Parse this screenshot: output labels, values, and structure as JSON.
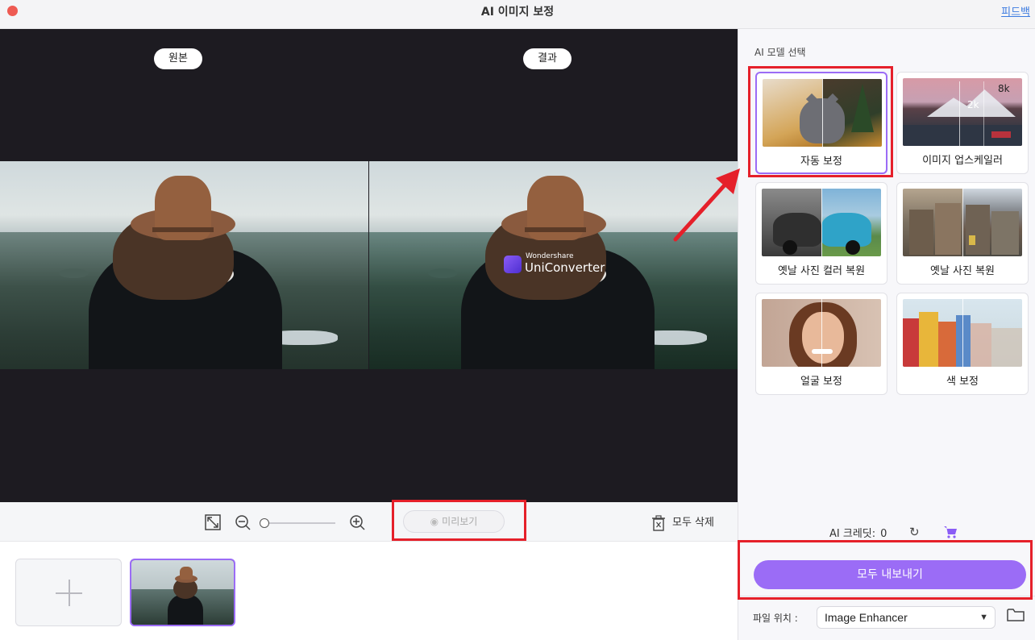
{
  "window": {
    "title": "AI 이미지 보정",
    "feedback_link": "피드백"
  },
  "preview": {
    "original_label": "원본",
    "result_label": "결과",
    "watermark": {
      "brand_small": "Wondershare",
      "brand_big": "UniConverter"
    }
  },
  "toolbar": {
    "preview_button": "미리보기",
    "delete_all": "모두 삭제",
    "zoom_level": 0
  },
  "panel": {
    "section_title": "AI 모델 선택",
    "models": [
      {
        "label": "자동 보정",
        "selected": true
      },
      {
        "label": "이미지 업스케일러",
        "selected": false,
        "badge_8k": "8k",
        "badge_2k": "2k"
      },
      {
        "label": "옛날 사진 컬러 복원",
        "selected": false
      },
      {
        "label": "옛날 사진 복원",
        "selected": false
      },
      {
        "label": "얼굴 보정",
        "selected": false
      },
      {
        "label": "색 보정",
        "selected": false
      }
    ],
    "credits_label": "AI 크레딧:",
    "credits_value": "0",
    "export_button": "모두 내보내기",
    "file_location_label": "파일 위치 :",
    "file_location_value": "Image Enhancer"
  },
  "colors": {
    "accent": "#9b6cf6",
    "annotation_red": "#e5202a",
    "preview_bg": "#1d1b21",
    "link": "#3c7be0"
  },
  "icons": [
    "close-icon",
    "fit-screen-icon",
    "zoom-out-icon",
    "zoom-in-icon",
    "eye-icon",
    "trash-icon",
    "refresh-icon",
    "cart-icon",
    "chevron-down-icon",
    "folder-icon",
    "plus-icon"
  ]
}
